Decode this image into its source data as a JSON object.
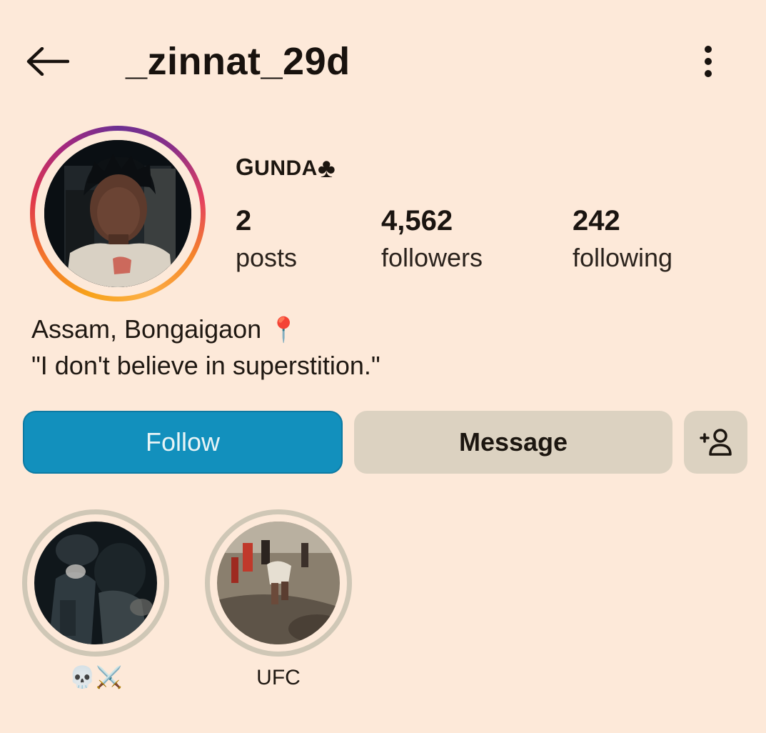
{
  "header": {
    "username": "_zinnat_29d",
    "back_icon": "arrow-left-icon",
    "more_icon": "more-vertical-icon"
  },
  "profile": {
    "display_name_initial": "G",
    "display_name_rest": "UNDA",
    "display_name_emoji": "♣",
    "stats": {
      "posts": {
        "value": "2",
        "label": "posts"
      },
      "followers": {
        "value": "4,562",
        "label": "followers"
      },
      "following": {
        "value": "242",
        "label": "following"
      }
    },
    "bio": {
      "line1": "Assam, Bongaigaon",
      "line1_emoji": "📍",
      "line2": "\"I don't believe in superstition.\""
    }
  },
  "actions": {
    "follow_label": "Follow",
    "message_label": "Message",
    "add_person_icon": "person-add-icon"
  },
  "highlights": [
    {
      "label": "💀⚔️"
    },
    {
      "label": "UFC"
    }
  ],
  "colors": {
    "background": "#fde9d9",
    "follow_button": "#1290bd",
    "secondary_button": "#dcd2c1"
  }
}
